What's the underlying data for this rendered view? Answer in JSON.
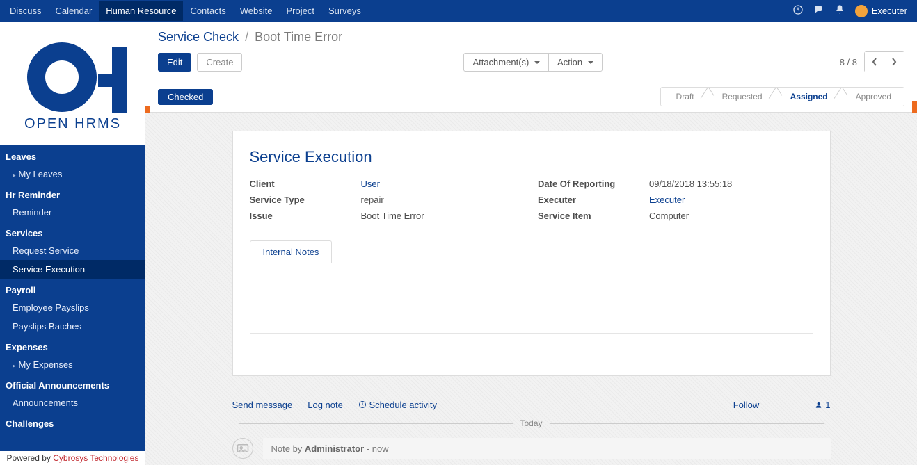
{
  "topnav": {
    "items": [
      "Discuss",
      "Calendar",
      "Human Resource",
      "Contacts",
      "Website",
      "Project",
      "Surveys"
    ],
    "active_index": 2,
    "user": "Executer"
  },
  "logo": {
    "text": "OPEN HRMS"
  },
  "sidebar": {
    "sections": [
      {
        "title": "Leaves",
        "items": [
          {
            "label": "My Leaves",
            "caret": true
          }
        ]
      },
      {
        "title": "Hr Reminder",
        "items": [
          {
            "label": "Reminder"
          }
        ]
      },
      {
        "title": "Services",
        "items": [
          {
            "label": "Request Service"
          },
          {
            "label": "Service Execution",
            "active": true
          }
        ]
      },
      {
        "title": "Payroll",
        "items": [
          {
            "label": "Employee Payslips"
          },
          {
            "label": "Payslips Batches"
          }
        ]
      },
      {
        "title": "Expenses",
        "items": [
          {
            "label": "My Expenses",
            "caret": true
          }
        ]
      },
      {
        "title": "Official Announcements",
        "items": [
          {
            "label": "Announcements"
          }
        ]
      },
      {
        "title": "Challenges",
        "items": []
      }
    ],
    "footer_prefix": "Powered by ",
    "footer_link": "Cybrosys Technologies"
  },
  "breadcrumb": {
    "root": "Service Check",
    "current": "Boot Time Error"
  },
  "toolbar": {
    "edit": "Edit",
    "create": "Create",
    "attachments": "Attachment(s)",
    "action": "Action",
    "pager": "8 / 8"
  },
  "status": {
    "checked": "Checked",
    "steps": [
      "Draft",
      "Requested",
      "Assigned",
      "Approved"
    ],
    "active_index": 2
  },
  "sheet": {
    "title": "Service Execution",
    "left": [
      {
        "label": "Client",
        "value": "User",
        "link": true
      },
      {
        "label": "Service Type",
        "value": "repair"
      },
      {
        "label": "Issue",
        "value": "Boot Time Error"
      }
    ],
    "right": [
      {
        "label": "Date Of Reporting",
        "value": "09/18/2018 13:55:18"
      },
      {
        "label": "Executer",
        "value": "Executer",
        "link": true
      },
      {
        "label": "Service Item",
        "value": "Computer"
      }
    ],
    "tab": "Internal Notes"
  },
  "chatter": {
    "send": "Send message",
    "log": "Log note",
    "schedule": "Schedule activity",
    "follow": "Follow",
    "follower_count": "1",
    "today": "Today",
    "note_prefix": "Note by ",
    "note_author": "Administrator",
    "note_suffix": " - now"
  }
}
